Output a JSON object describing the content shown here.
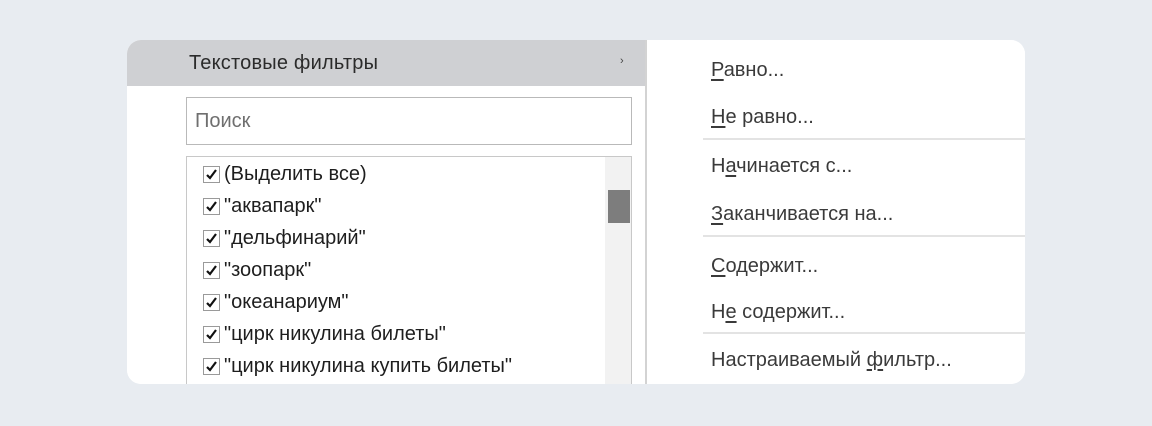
{
  "menu": {
    "text_filters_label": "Текстовые фильтры",
    "submenu_arrow": "›"
  },
  "search": {
    "placeholder": "Поиск",
    "value": ""
  },
  "list": {
    "items": [
      {
        "label": "(Выделить все)",
        "checked": true
      },
      {
        "label": "\"аквапарк\"",
        "checked": true
      },
      {
        "label": "\"дельфинарий\"",
        "checked": true
      },
      {
        "label": "\"зоопарк\"",
        "checked": true
      },
      {
        "label": "\"океанариум\"",
        "checked": true
      },
      {
        "label": "\"цирк никулина билеты\"",
        "checked": true
      },
      {
        "label": "\"цирк никулина купить билеты\"",
        "checked": true
      }
    ]
  },
  "submenu": {
    "equals": {
      "pre": "",
      "u": "Р",
      "post": "авно..."
    },
    "not_equals": {
      "pre": "",
      "u": "Н",
      "post": "е равно..."
    },
    "begins_with": {
      "pre": "Н",
      "u": "а",
      "post": "чинается с..."
    },
    "ends_with": {
      "pre": "",
      "u": "З",
      "post": "аканчивается на..."
    },
    "contains": {
      "pre": "",
      "u": "С",
      "post": "одержит..."
    },
    "not_contains": {
      "pre": "Н",
      "u": "е",
      "post": " содержит..."
    },
    "custom": {
      "pre": "Настраиваемый ",
      "u": "ф",
      "post": "ильтр..."
    }
  }
}
